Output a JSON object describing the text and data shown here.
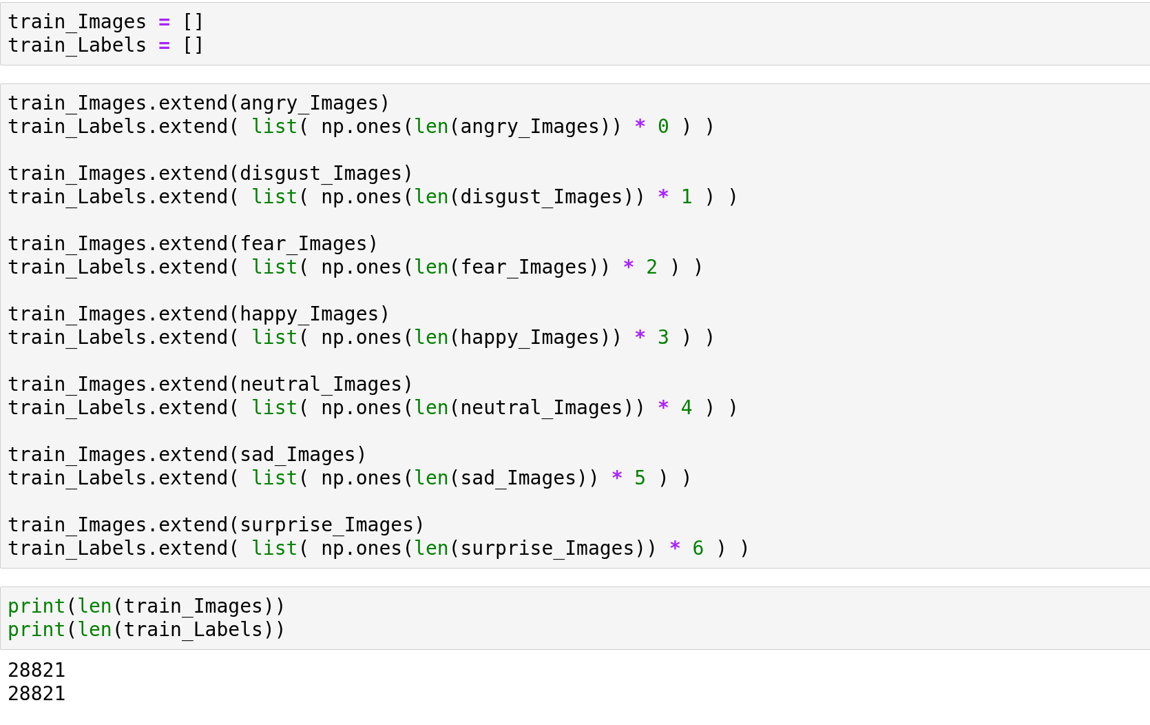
{
  "cells": [
    {
      "blocks": [
        [
          [
            {
              "kind": "plain",
              "text": "train_Images "
            },
            {
              "kind": "op",
              "text": "="
            },
            {
              "kind": "plain",
              "text": " []"
            }
          ],
          [
            {
              "kind": "plain",
              "text": "train_Labels "
            },
            {
              "kind": "op",
              "text": "="
            },
            {
              "kind": "plain",
              "text": " []"
            }
          ]
        ]
      ]
    },
    {
      "blocks": [
        [
          [
            {
              "kind": "plain",
              "text": "train_Images.extend(angry_Images)"
            }
          ],
          [
            {
              "kind": "plain",
              "text": "train_Labels.extend( "
            },
            {
              "kind": "builtin",
              "text": "list"
            },
            {
              "kind": "plain",
              "text": "( np.ones("
            },
            {
              "kind": "builtin",
              "text": "len"
            },
            {
              "kind": "plain",
              "text": "(angry_Images)) "
            },
            {
              "kind": "op",
              "text": "*"
            },
            {
              "kind": "number",
              "text": " 0"
            },
            {
              "kind": "plain",
              "text": " ) )"
            }
          ]
        ],
        [
          [
            {
              "kind": "plain",
              "text": "train_Images.extend(disgust_Images)"
            }
          ],
          [
            {
              "kind": "plain",
              "text": "train_Labels.extend( "
            },
            {
              "kind": "builtin",
              "text": "list"
            },
            {
              "kind": "plain",
              "text": "( np.ones("
            },
            {
              "kind": "builtin",
              "text": "len"
            },
            {
              "kind": "plain",
              "text": "(disgust_Images)) "
            },
            {
              "kind": "op",
              "text": "*"
            },
            {
              "kind": "number",
              "text": " 1"
            },
            {
              "kind": "plain",
              "text": " ) )"
            }
          ]
        ],
        [
          [
            {
              "kind": "plain",
              "text": "train_Images.extend(fear_Images)"
            }
          ],
          [
            {
              "kind": "plain",
              "text": "train_Labels.extend( "
            },
            {
              "kind": "builtin",
              "text": "list"
            },
            {
              "kind": "plain",
              "text": "( np.ones("
            },
            {
              "kind": "builtin",
              "text": "len"
            },
            {
              "kind": "plain",
              "text": "(fear_Images)) "
            },
            {
              "kind": "op",
              "text": "*"
            },
            {
              "kind": "number",
              "text": " 2"
            },
            {
              "kind": "plain",
              "text": " ) )"
            }
          ]
        ],
        [
          [
            {
              "kind": "plain",
              "text": "train_Images.extend(happy_Images)"
            }
          ],
          [
            {
              "kind": "plain",
              "text": "train_Labels.extend( "
            },
            {
              "kind": "builtin",
              "text": "list"
            },
            {
              "kind": "plain",
              "text": "( np.ones("
            },
            {
              "kind": "builtin",
              "text": "len"
            },
            {
              "kind": "plain",
              "text": "(happy_Images)) "
            },
            {
              "kind": "op",
              "text": "*"
            },
            {
              "kind": "number",
              "text": " 3"
            },
            {
              "kind": "plain",
              "text": " ) )"
            }
          ]
        ],
        [
          [
            {
              "kind": "plain",
              "text": "train_Images.extend(neutral_Images)"
            }
          ],
          [
            {
              "kind": "plain",
              "text": "train_Labels.extend( "
            },
            {
              "kind": "builtin",
              "text": "list"
            },
            {
              "kind": "plain",
              "text": "( np.ones("
            },
            {
              "kind": "builtin",
              "text": "len"
            },
            {
              "kind": "plain",
              "text": "(neutral_Images)) "
            },
            {
              "kind": "op",
              "text": "*"
            },
            {
              "kind": "number",
              "text": " 4"
            },
            {
              "kind": "plain",
              "text": " ) )"
            }
          ]
        ],
        [
          [
            {
              "kind": "plain",
              "text": "train_Images.extend(sad_Images)"
            }
          ],
          [
            {
              "kind": "plain",
              "text": "train_Labels.extend( "
            },
            {
              "kind": "builtin",
              "text": "list"
            },
            {
              "kind": "plain",
              "text": "( np.ones("
            },
            {
              "kind": "builtin",
              "text": "len"
            },
            {
              "kind": "plain",
              "text": "(sad_Images)) "
            },
            {
              "kind": "op",
              "text": "*"
            },
            {
              "kind": "number",
              "text": " 5"
            },
            {
              "kind": "plain",
              "text": " ) )"
            }
          ]
        ],
        [
          [
            {
              "kind": "plain",
              "text": "train_Images.extend(surprise_Images)"
            }
          ],
          [
            {
              "kind": "plain",
              "text": "train_Labels.extend( "
            },
            {
              "kind": "builtin",
              "text": "list"
            },
            {
              "kind": "plain",
              "text": "( np.ones("
            },
            {
              "kind": "builtin",
              "text": "len"
            },
            {
              "kind": "plain",
              "text": "(surprise_Images)) "
            },
            {
              "kind": "op",
              "text": "*"
            },
            {
              "kind": "number",
              "text": " 6"
            },
            {
              "kind": "plain",
              "text": " ) )"
            }
          ]
        ]
      ]
    },
    {
      "blocks": [
        [
          [
            {
              "kind": "builtin",
              "text": "print"
            },
            {
              "kind": "plain",
              "text": "("
            },
            {
              "kind": "builtin",
              "text": "len"
            },
            {
              "kind": "plain",
              "text": "(train_Images))"
            }
          ],
          [
            {
              "kind": "builtin",
              "text": "print"
            },
            {
              "kind": "plain",
              "text": "("
            },
            {
              "kind": "builtin",
              "text": "len"
            },
            {
              "kind": "plain",
              "text": "(train_Labels))"
            }
          ]
        ]
      ],
      "output": [
        "28821",
        "28821"
      ]
    }
  ]
}
